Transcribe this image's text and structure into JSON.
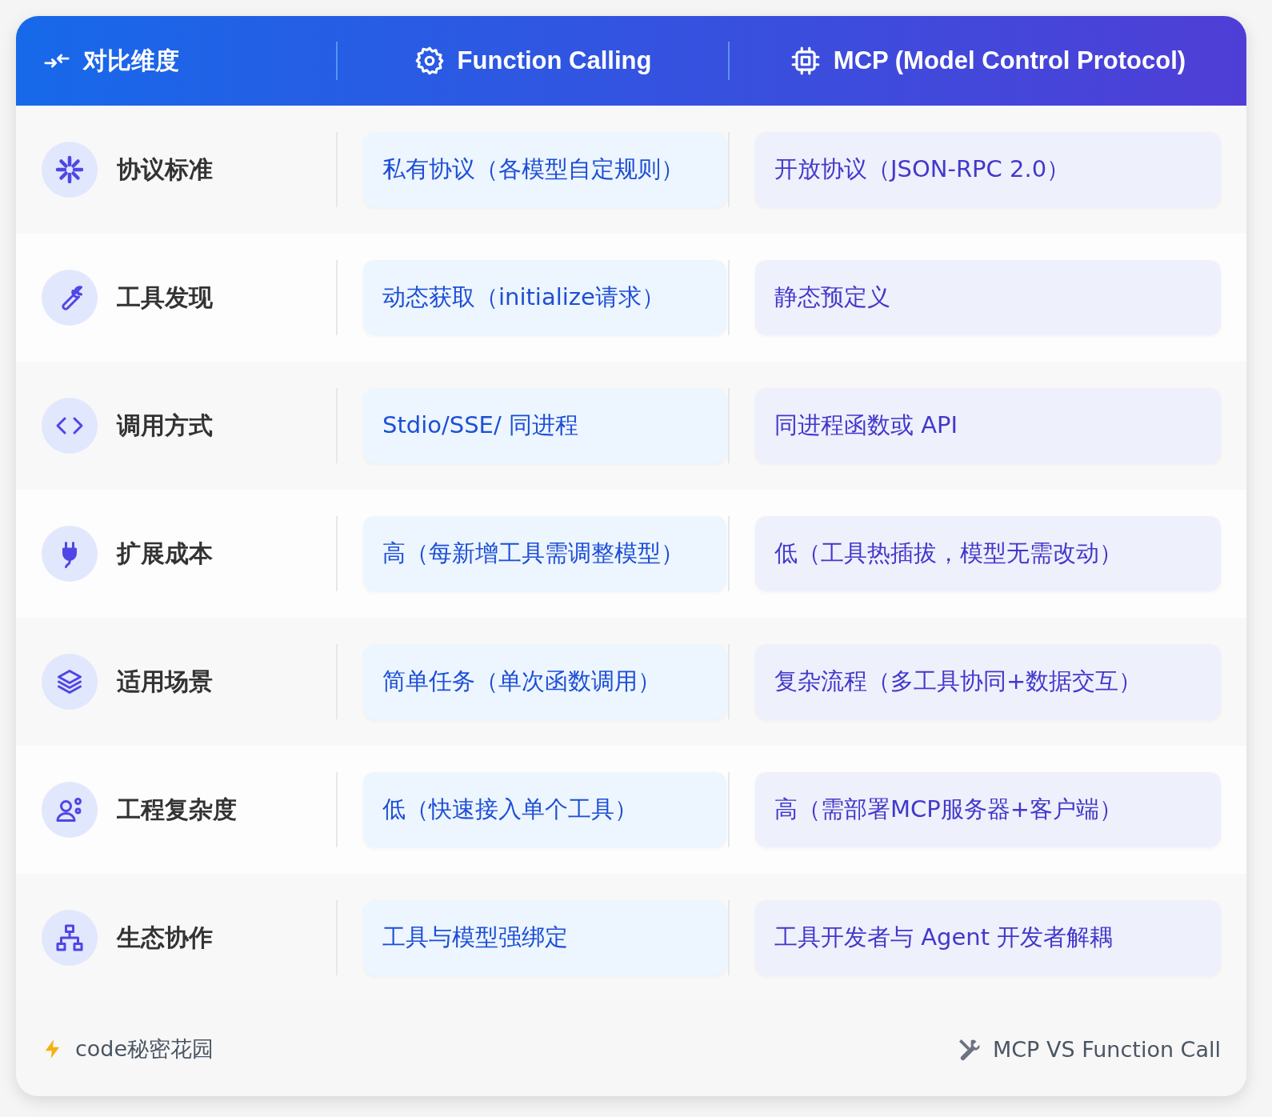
{
  "header": {
    "columns": [
      {
        "label": "对比维度"
      },
      {
        "label": "Function Calling"
      },
      {
        "label": "MCP (Model Control Protocol)"
      }
    ]
  },
  "rows": [
    {
      "dimension": "协议标准",
      "function_calling": "私有协议（各模型自定规则）",
      "mcp": "开放协议（JSON-RPC 2.0）"
    },
    {
      "dimension": "工具发现",
      "function_calling": "动态获取（initialize请求）",
      "mcp": "静态预定义"
    },
    {
      "dimension": "调用方式",
      "function_calling": "Stdio/SSE/ 同进程",
      "mcp": "同进程函数或 API"
    },
    {
      "dimension": "扩展成本",
      "function_calling": "高（每新增工具需调整模型）",
      "mcp": "低（工具热插拔，模型无需改动）"
    },
    {
      "dimension": "适用场景",
      "function_calling": "简单任务（单次函数调用）",
      "mcp": "复杂流程（多工具协同+数据交互）"
    },
    {
      "dimension": "工程复杂度",
      "function_calling": "低（快速接入单个工具）",
      "mcp": "高（需部署MCP服务器+客户端）"
    },
    {
      "dimension": "生态协作",
      "function_calling": "工具与模型强绑定",
      "mcp": "工具开发者与 Agent 开发者解耦"
    }
  ],
  "footer": {
    "brand": "code秘密花园",
    "caption": "MCP VS Function Call"
  }
}
